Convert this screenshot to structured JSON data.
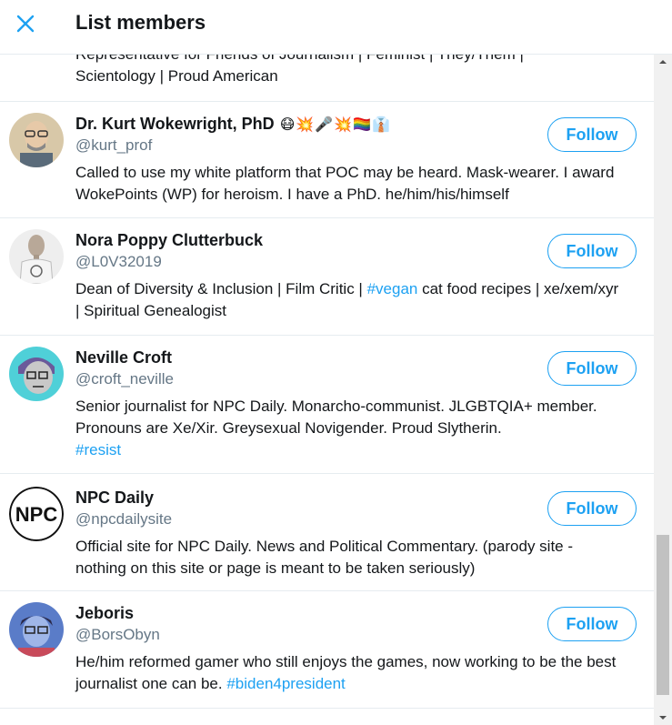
{
  "header": {
    "title": "List members",
    "close_icon": "close-icon"
  },
  "partial_member": {
    "bio_line1": "Representative for Friends of Journalism | Feminist | They/Them |",
    "bio_line2": "Scientology | Proud American"
  },
  "members": [
    {
      "name": "Dr. Kurt Wokewright, PhD",
      "emojis": "😷💥🎤💥🏳️‍🌈👔",
      "handle": "@kurt_prof",
      "bio": "Called to use my white platform that POC may be heard. Mask-wearer. I award WokePoints (WP) for heroism. I have a PhD. he/him/his/himself",
      "follow": "Follow"
    },
    {
      "name": "Nora Poppy Clutterbuck",
      "handle": "@L0V32019",
      "bio_pre": "Dean of Diversity & Inclusion | Film Critic | ",
      "bio_tag": "#vegan",
      "bio_post": " cat food recipes | xe/xem/xyr | Spiritual Genealogist",
      "follow": "Follow"
    },
    {
      "name": "Neville Croft",
      "handle": "@croft_neville",
      "bio_pre": "Senior journalist for NPC Daily. Monarcho-communist. JLGBTQIA+ member. Pronouns are Xe/Xir. Greysexual Novigender. Proud Slytherin.",
      "bio_tag": "#resist",
      "follow": "Follow"
    },
    {
      "name": "NPC Daily",
      "handle": "@npcdailysite",
      "bio": "Official site for NPC Daily. News and Political Commentary. (parody site - nothing on this site or page is meant to be taken seriously)",
      "avatar_text": "NPC",
      "follow": "Follow"
    },
    {
      "name": "Jeboris",
      "handle": "@BorsObyn",
      "bio_pre": "He/him reformed gamer who still enjoys the games, now working to be the best journalist one can be. ",
      "bio_tag": "#biden4president",
      "follow": "Follow"
    }
  ],
  "colors": {
    "accent": "#1da1f2",
    "text": "#14171a",
    "muted": "#657786",
    "divider": "#e6ecf0"
  }
}
